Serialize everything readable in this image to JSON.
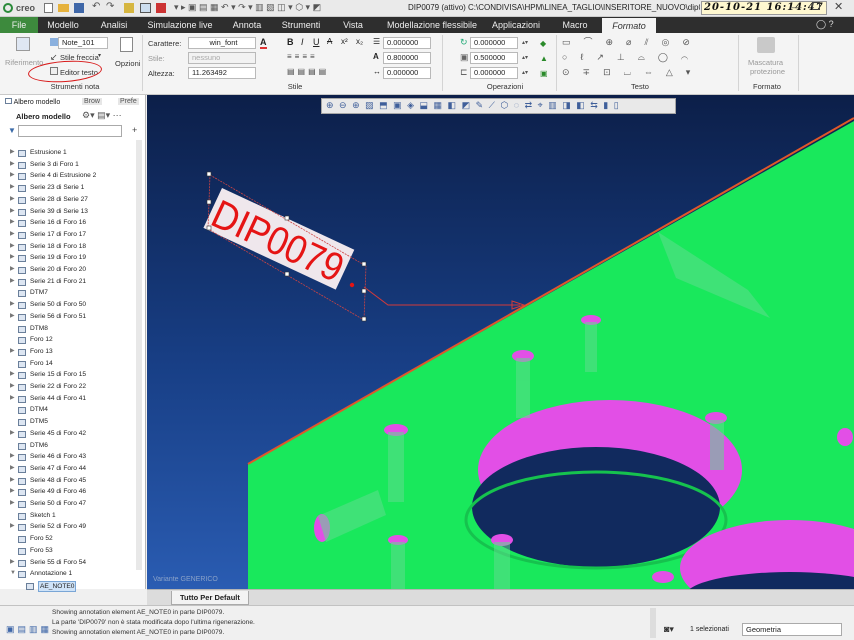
{
  "titlebar": {
    "app_name": "creo",
    "title": "DIP0079 (attivo) C:\\CONDIVISA\\HPM\\LINEA_TAGLIO\\INSERITORE_NUOVO\\dip0079",
    "clock": "20-10-21  16:14:47"
  },
  "menu": [
    "File",
    "Modello",
    "Analisi",
    "Simulazione live",
    "Annota",
    "Strumenti",
    "Vista",
    "Modellazione flessibile",
    "Applicazioni",
    "Macro",
    "Formato"
  ],
  "ribbon": {
    "riferimento_label": "Riferimento",
    "note_name": "Note_101",
    "stile_freccia": "Stile freccia",
    "editor_testo": "Editor testo",
    "opzioni": "Opzioni",
    "strumenti_nota": "Strumenti nota",
    "carattere_label": "Carattere:",
    "carattere_value": "win_font",
    "stile_label": "Stile:",
    "stile_value": "nessuno",
    "altezza_label": "Altezza:",
    "altezza_value": "11.263492",
    "num_a": "0.000000",
    "num_b": "0.800000",
    "num_c": "0.000000",
    "num_d": "0.000000",
    "num_e": "0.500000",
    "num_f": "0.000000",
    "group_stile": "Stile",
    "group_operazioni": "Operazioni",
    "group_testo": "Testo",
    "group_formato": "Formato",
    "maschera_line1": "Mascatura",
    "maschera_line2": "protezione"
  },
  "tree": {
    "tab_albero": "Albero modello",
    "tab_browser": "Brow",
    "tab_prefe": "Prefe",
    "header": "Albero modello",
    "items": [
      {
        "arrow": "▶",
        "label": "Estrusione 1"
      },
      {
        "arrow": "▶",
        "label": "Serie 3 di Foro 1"
      },
      {
        "arrow": "▶",
        "label": "Serie 4 di Estrusione 2"
      },
      {
        "arrow": "▶",
        "label": "Serie 23 di Serie 1"
      },
      {
        "arrow": "▶",
        "label": "Serie 28 di Serie 27"
      },
      {
        "arrow": "▶",
        "label": "Serie 39 di Serie 13"
      },
      {
        "arrow": "▶",
        "label": "Serie 16 di Foro 16"
      },
      {
        "arrow": "▶",
        "label": "Serie 17 di Foro 17"
      },
      {
        "arrow": "▶",
        "label": "Serie 18 di Foro 18"
      },
      {
        "arrow": "▶",
        "label": "Serie 19 di Foro 19"
      },
      {
        "arrow": "▶",
        "label": "Serie 20 di Foro 20"
      },
      {
        "arrow": "▶",
        "label": "Serie 21 di Foro 21"
      },
      {
        "arrow": "",
        "label": "DTM7"
      },
      {
        "arrow": "▶",
        "label": "Serie 50 di Foro 50"
      },
      {
        "arrow": "▶",
        "label": "Serie 56 di Foro 51"
      },
      {
        "arrow": "",
        "label": "DTM8"
      },
      {
        "arrow": "",
        "label": "Foro 12"
      },
      {
        "arrow": "▶",
        "label": "Foro 13"
      },
      {
        "arrow": "",
        "label": "Foro 14"
      },
      {
        "arrow": "▶",
        "label": "Serie 15 di Foro 15"
      },
      {
        "arrow": "▶",
        "label": "Serie 22 di Foro 22"
      },
      {
        "arrow": "▶",
        "label": "Serie 44 di Foro 41"
      },
      {
        "arrow": "",
        "label": "DTM4"
      },
      {
        "arrow": "",
        "label": "DTM5"
      },
      {
        "arrow": "▶",
        "label": "Serie 45 di Foro 42"
      },
      {
        "arrow": "",
        "label": "DTM6"
      },
      {
        "arrow": "▶",
        "label": "Serie 46 di Foro 43"
      },
      {
        "arrow": "▶",
        "label": "Serie 47 di Foro 44"
      },
      {
        "arrow": "▶",
        "label": "Serie 48 di Foro 45"
      },
      {
        "arrow": "▶",
        "label": "Serie 49 di Foro 46"
      },
      {
        "arrow": "▶",
        "label": "Serie 50 di Foro 47"
      },
      {
        "arrow": "",
        "label": "Sketch 1"
      },
      {
        "arrow": "▶",
        "label": "Serie 52 di Foro 49"
      },
      {
        "arrow": "",
        "label": "Foro 52"
      },
      {
        "arrow": "",
        "label": "Foro 53"
      },
      {
        "arrow": "▶",
        "label": "Serie 55 di Foro 54"
      },
      {
        "arrow": "▼",
        "label": "Annotazione 1"
      },
      {
        "arrow": "",
        "label": "AE_NOTE0"
      }
    ]
  },
  "viewport": {
    "note_text": "DIP0079",
    "variante": "Variante GENERICO"
  },
  "tabbar": {
    "tab": "Tutto Per Default"
  },
  "status": {
    "messages": [
      "Showing annotation element AE_NOTE0 in parte DIP0079.",
      "La parte 'DIP0079' non è stata modificata dopo l'ultima rigenerazione.",
      "Showing annotation element AE_NOTE0 in parte DIP0079."
    ],
    "selected": "1 selezionati",
    "filter": "Geometria"
  },
  "colors": {
    "part_green": "#19e85c",
    "hole_magenta": "#e24fe6",
    "note_red": "#e51414",
    "menubar": "#2e2e2e",
    "file_tab": "#3d8a3d"
  }
}
